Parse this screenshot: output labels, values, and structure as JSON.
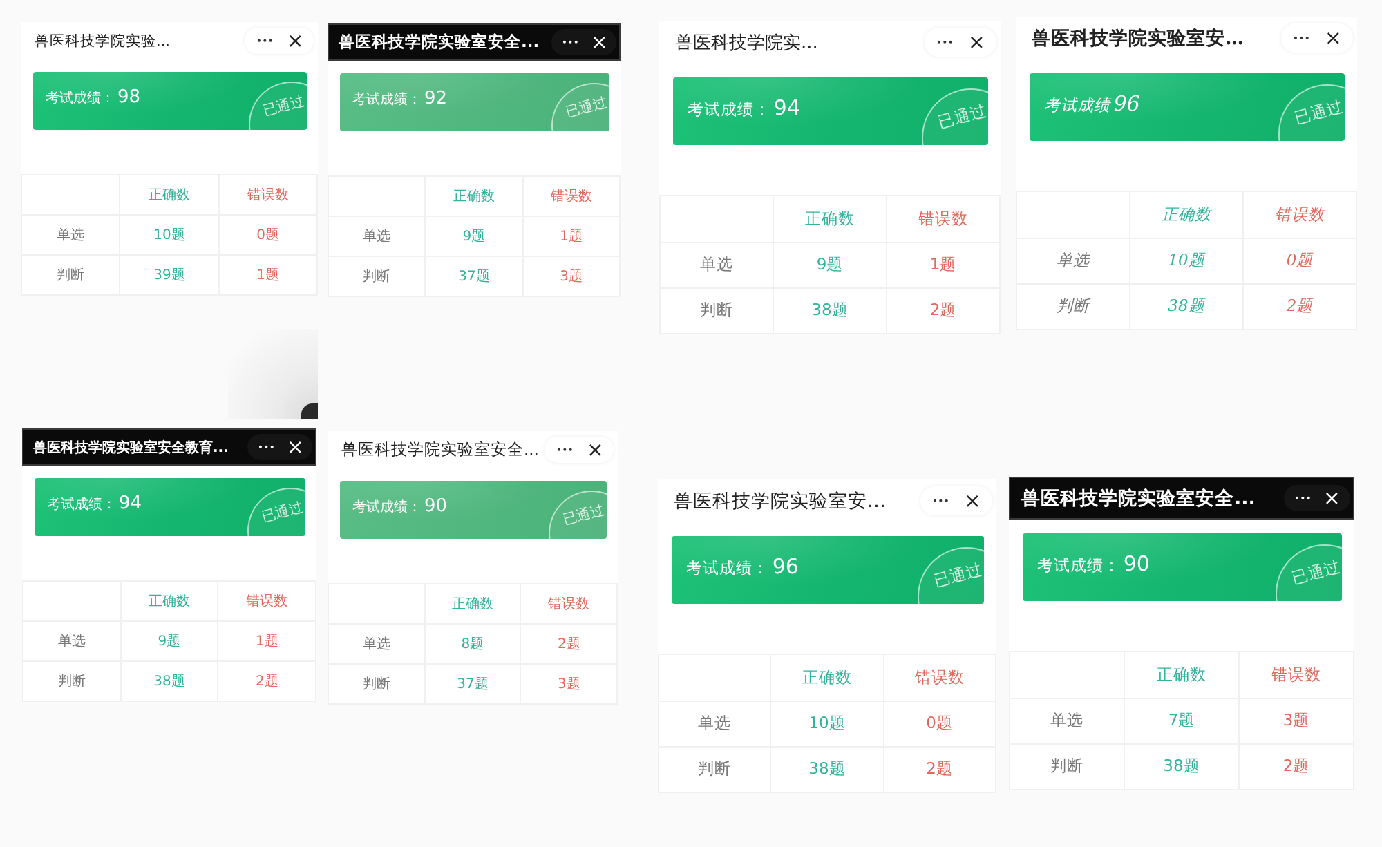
{
  "tiles": [
    {
      "kind": "plain",
      "title": "兽医科技学院实验...",
      "score_label": "考试成绩：",
      "score": "98",
      "stamp": "已通过",
      "table": {
        "columns": [
          "正确数",
          "错误数"
        ],
        "rows": [
          {
            "label": "单选",
            "correct": "10题",
            "wrong": "0题"
          },
          {
            "label": "判断",
            "correct": "39题",
            "wrong": "1题"
          }
        ]
      }
    },
    {
      "kind": "dark-bar",
      "title": "兽医科技学院实验室安全...",
      "score_label": "考试成绩：",
      "score": "92",
      "stamp": "已通过",
      "table": {
        "columns": [
          "正确数",
          "错误数"
        ],
        "rows": [
          {
            "label": "单选",
            "correct": "9题",
            "wrong": "1题"
          },
          {
            "label": "判断",
            "correct": "37题",
            "wrong": "3题"
          }
        ]
      }
    },
    {
      "kind": "plain",
      "title": "兽医科技学院实...",
      "score_label": "考试成绩：",
      "score": "94",
      "stamp": "已通过",
      "table": {
        "columns": [
          "正确数",
          "错误数"
        ],
        "rows": [
          {
            "label": "单选",
            "correct": "9题",
            "wrong": "1题"
          },
          {
            "label": "判断",
            "correct": "38题",
            "wrong": "2题"
          }
        ]
      }
    },
    {
      "kind": "plain",
      "title": "兽医科技学院实验室安…",
      "score_label": "考试成绩",
      "score": "96",
      "stamp": "已通过",
      "table": {
        "columns": [
          "正确数",
          "错误数"
        ],
        "rows": [
          {
            "label": "单选",
            "correct": "10题",
            "wrong": "0题"
          },
          {
            "label": "判断",
            "correct": "38题",
            "wrong": "2题"
          }
        ]
      }
    },
    {
      "kind": "dark-bar",
      "title": "兽医科技学院实验室安全教育...",
      "score_label": "考试成绩：",
      "score": "94",
      "stamp": "已通过",
      "table": {
        "columns": [
          "正确数",
          "错误数"
        ],
        "rows": [
          {
            "label": "单选",
            "correct": "9题",
            "wrong": "1题"
          },
          {
            "label": "判断",
            "correct": "38题",
            "wrong": "2题"
          }
        ]
      }
    },
    {
      "kind": "plain",
      "title": "兽医科技学院实验室安全...",
      "score_label": "考试成绩：",
      "score": "90",
      "stamp": "已通过",
      "table": {
        "columns": [
          "正确数",
          "错误数"
        ],
        "rows": [
          {
            "label": "单选",
            "correct": "8题",
            "wrong": "2题"
          },
          {
            "label": "判断",
            "correct": "37题",
            "wrong": "3题"
          }
        ]
      }
    },
    {
      "kind": "plain",
      "title": "兽医科技学院实验室安…",
      "score_label": "考试成绩：",
      "score": "96",
      "stamp": "已通过",
      "table": {
        "columns": [
          "正确数",
          "错误数"
        ],
        "rows": [
          {
            "label": "单选",
            "correct": "10题",
            "wrong": "0题"
          },
          {
            "label": "判断",
            "correct": "38题",
            "wrong": "2题"
          }
        ]
      }
    },
    {
      "kind": "dark-bar",
      "title": "兽医科技学院实验室安全...",
      "score_label": "考试成绩：",
      "score": "90",
      "stamp": "已通过",
      "table": {
        "columns": [
          "正确数",
          "错误数"
        ],
        "rows": [
          {
            "label": "单选",
            "correct": "7题",
            "wrong": "3题"
          },
          {
            "label": "判断",
            "correct": "38题",
            "wrong": "2题"
          }
        ]
      }
    }
  ]
}
